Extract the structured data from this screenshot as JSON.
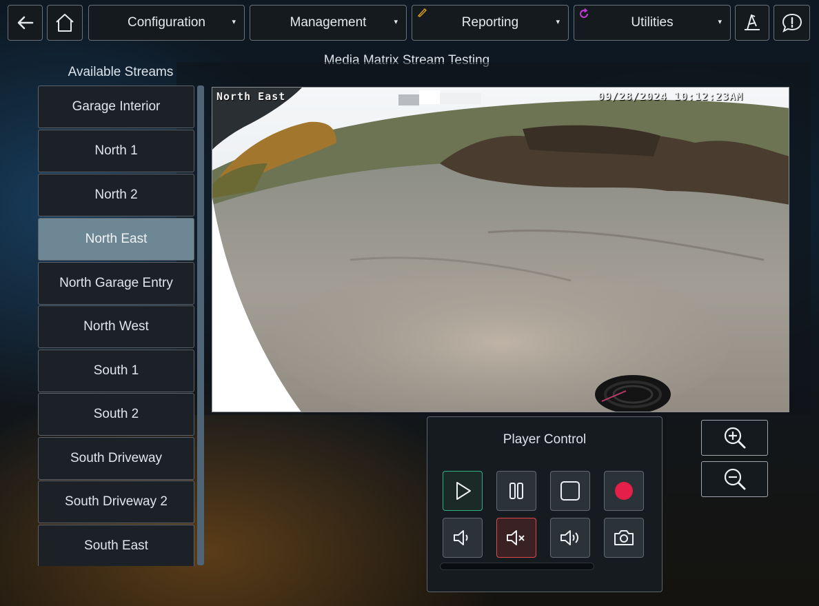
{
  "nav": {
    "configuration": "Configuration",
    "management": "Management",
    "reporting": "Reporting",
    "utilities": "Utilities",
    "caret": "▾",
    "reporting_icon": "pen-icon",
    "utilities_icon": "refresh-icon"
  },
  "page": {
    "title": "Media Matrix Stream Testing"
  },
  "sidebar": {
    "title": "Available Streams",
    "items": [
      {
        "label": "Garage Interior",
        "active": false
      },
      {
        "label": "North 1",
        "active": false
      },
      {
        "label": "North 2",
        "active": false
      },
      {
        "label": "North East",
        "active": true
      },
      {
        "label": "North Garage Entry",
        "active": false
      },
      {
        "label": "North West",
        "active": false
      },
      {
        "label": "South 1",
        "active": false
      },
      {
        "label": "South 2",
        "active": false
      },
      {
        "label": "South Driveway",
        "active": false
      },
      {
        "label": "South Driveway 2",
        "active": false
      },
      {
        "label": "South East",
        "active": false
      }
    ]
  },
  "video": {
    "camera_name": "North East",
    "timestamp": "09/28/2024 10:12:23AM"
  },
  "player": {
    "title": "Player Control",
    "progress": 0
  },
  "colors": {
    "accent_green": "#33b083",
    "record_red": "#e31f4a",
    "mute_red": "#e04949",
    "active_stream": "#6e8794"
  }
}
